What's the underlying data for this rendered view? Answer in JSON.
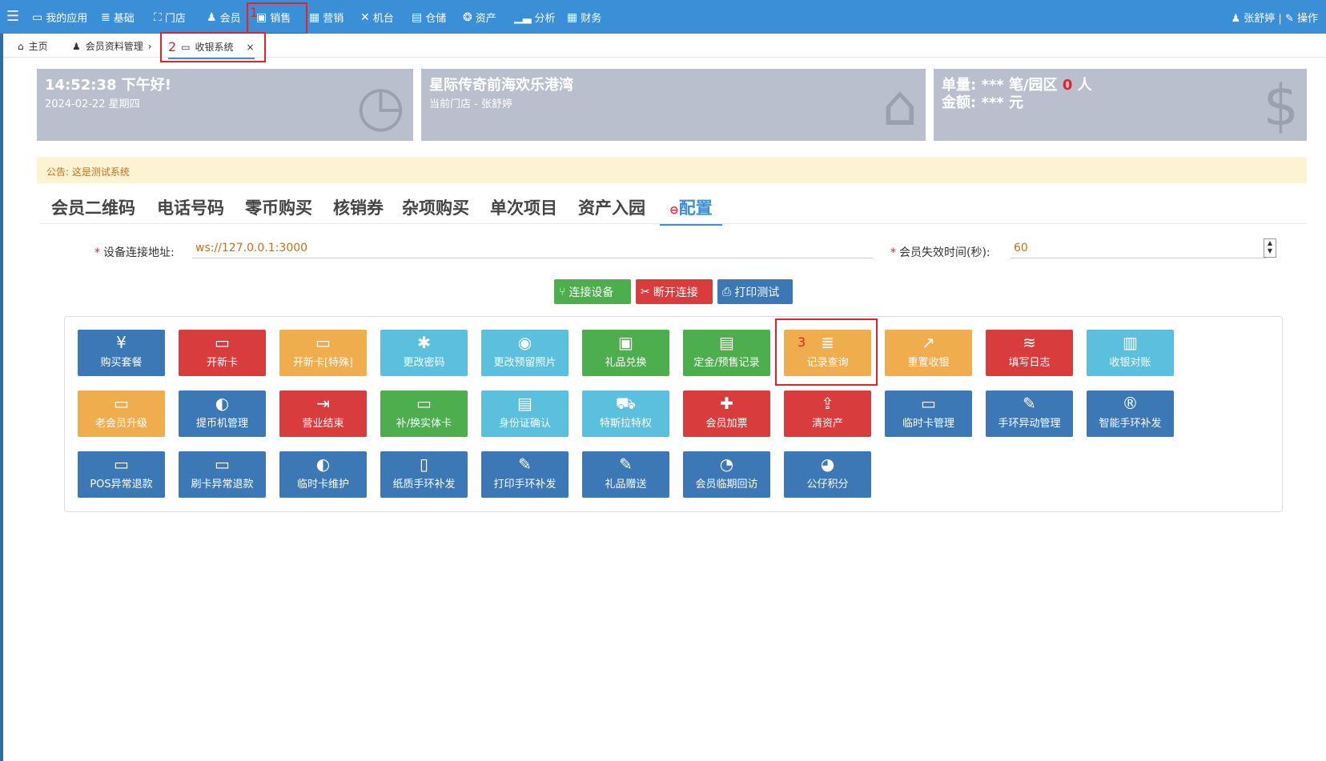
{
  "topbar": {
    "menu_icon": "hamburger-icon",
    "items": [
      {
        "label": "我的应用",
        "icon": "laptop-icon"
      },
      {
        "label": "基础",
        "icon": "database-icon"
      },
      {
        "label": "门店",
        "icon": "sitemap-icon"
      },
      {
        "label": "会员",
        "icon": "user-icon"
      },
      {
        "label": "销售",
        "icon": "briefcase-icon"
      },
      {
        "label": "营销",
        "icon": "shop-icon"
      },
      {
        "label": "机台",
        "icon": "tools-icon"
      },
      {
        "label": "仓储",
        "icon": "box-icon"
      },
      {
        "label": "资产",
        "icon": "coins-icon"
      },
      {
        "label": "分析",
        "icon": "chart-icon"
      },
      {
        "label": "财务",
        "icon": "calculator-icon"
      }
    ],
    "user": "张舒婷",
    "separator": "|",
    "ops": "操作"
  },
  "tabs": {
    "home": "主页",
    "member": "会员资料管理",
    "cashier": "收银系统",
    "close": "×",
    "chevron": "›"
  },
  "annotations": {
    "a1": "1",
    "a2": "2",
    "a3": "3"
  },
  "panels": {
    "time": "14:52:38 下午好!",
    "date": "2024-02-22 星期四",
    "store_name": "星际传奇前海欢乐港湾",
    "store_sub": "当前门店 - 张舒婷",
    "orders_prefix": "单量: *** 笔/园区",
    "orders_count": "0",
    "orders_suffix": "人",
    "amount": "金额: *** 元"
  },
  "notice": "公告: 这是测试系统",
  "big_tabs": [
    "会员二维码",
    "电话号码",
    "零币购买",
    "核销券",
    "杂项购买",
    "单次项目",
    "资产入园",
    "配置"
  ],
  "config": {
    "device_label": "设备连接地址:",
    "device_value": "ws://127.0.0.1:3000",
    "timeout_label": "会员失效时间(秒):",
    "timeout_value": "60",
    "required_mark": "*"
  },
  "actions": {
    "connect": "连接设备",
    "disconnect": "断开连接",
    "print": "打印测试"
  },
  "tiles": [
    {
      "label": "购买套餐",
      "icon": "¥",
      "color": "#3c78b6"
    },
    {
      "label": "开新卡",
      "icon": "▭",
      "color": "#d83c3c"
    },
    {
      "label": "开新卡[特殊]",
      "icon": "▭",
      "color": "#f0ad4e"
    },
    {
      "label": "更改密码",
      "icon": "✱",
      "color": "#5bc0de"
    },
    {
      "label": "更改预留照片",
      "icon": "◉",
      "color": "#5bc0de"
    },
    {
      "label": "礼品兑换",
      "icon": "▣",
      "color": "#4cae4c"
    },
    {
      "label": "定金/预售记录",
      "icon": "▤",
      "color": "#4cae4c"
    },
    {
      "label": "记录查询",
      "icon": "≣",
      "color": "#f0ad4e"
    },
    {
      "label": "重置收银",
      "icon": "↗",
      "color": "#f0ad4e"
    },
    {
      "label": "填写日志",
      "icon": "≋",
      "color": "#d83c3c"
    },
    {
      "label": "收银对账",
      "icon": "▥",
      "color": "#5bc0de"
    },
    {
      "label": "老会员升级",
      "icon": "▭",
      "color": "#f0ad4e"
    },
    {
      "label": "提币机管理",
      "icon": "◐",
      "color": "#3c78b6"
    },
    {
      "label": "营业结束",
      "icon": "⇥",
      "color": "#d83c3c"
    },
    {
      "label": "补/换实体卡",
      "icon": "▭",
      "color": "#4cae4c"
    },
    {
      "label": "身份证确认",
      "icon": "▤",
      "color": "#5bc0de"
    },
    {
      "label": "特斯拉特权",
      "icon": "⛟",
      "color": "#5bc0de"
    },
    {
      "label": "会员加票",
      "icon": "✚",
      "color": "#d83c3c"
    },
    {
      "label": "清资产",
      "icon": "⇪",
      "color": "#d83c3c"
    },
    {
      "label": "临时卡管理",
      "icon": "▭",
      "color": "#3c78b6"
    },
    {
      "label": "手环异动管理",
      "icon": "✎",
      "color": "#3c78b6"
    },
    {
      "label": "智能手环补发",
      "icon": "®",
      "color": "#3c78b6"
    },
    {
      "label": "POS异常退款",
      "icon": "▭",
      "color": "#3c78b6"
    },
    {
      "label": "刷卡异常退款",
      "icon": "▭",
      "color": "#3c78b6"
    },
    {
      "label": "临时卡维护",
      "icon": "◐",
      "color": "#3c78b6"
    },
    {
      "label": "纸质手环补发",
      "icon": "▯",
      "color": "#3c78b6"
    },
    {
      "label": "打印手环补发",
      "icon": "✎",
      "color": "#3c78b6"
    },
    {
      "label": "礼品赠送",
      "icon": "✎",
      "color": "#3c78b6"
    },
    {
      "label": "会员临期回访",
      "icon": "◔",
      "color": "#3c78b6"
    },
    {
      "label": "公仔积分",
      "icon": "◕",
      "color": "#3c78b6"
    }
  ]
}
